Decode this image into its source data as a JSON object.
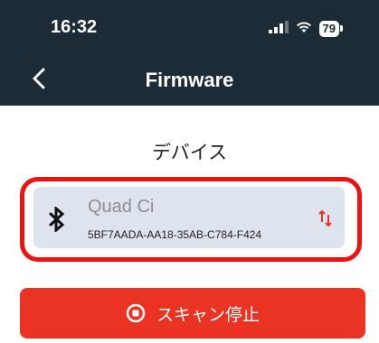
{
  "status_bar": {
    "time": "16:32",
    "battery_level": "79",
    "icons": [
      "signal-icon",
      "wifi-icon",
      "battery-icon"
    ]
  },
  "header": {
    "title": "Firmware",
    "back_icon": "chevron-left-icon"
  },
  "section": {
    "label": "デバイス"
  },
  "device": {
    "name": "Quad Ci",
    "id": "5BF7AADA-AA18-35AB-C784-F424",
    "icon": "bluetooth-icon",
    "signal_icon": "arrows-up-down-icon"
  },
  "scan_button": {
    "label": "スキャン停止",
    "icon": "stop-circle-icon"
  },
  "colors": {
    "header_bg": "#1c2b36",
    "card_bg": "#dde4ee",
    "highlight": "#ee1111",
    "button_bg": "#ea3323",
    "sort_icon": "#ea3323"
  }
}
